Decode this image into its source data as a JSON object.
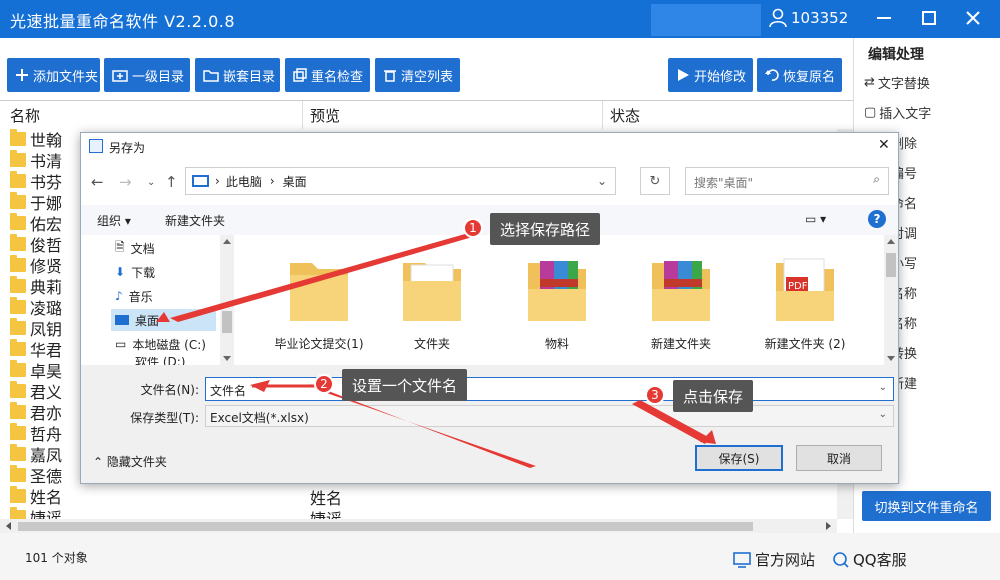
{
  "titlebar": {
    "title": "光速批量重命名软件 V2.2.0.8",
    "user_id": "103352"
  },
  "toolbar": {
    "add_files": "添加文件夹",
    "level1_dir": "一级目录",
    "nested_dir": "嵌套目录",
    "rename_check": "重名检查",
    "clear_list": "清空列表",
    "start_modify": "开始修改",
    "restore_name": "恢复原名"
  },
  "right_panel": {
    "heading": "编辑处理",
    "items": [
      "文字替换",
      "插入文字",
      "好删除",
      "字编号",
      "机命名",
      "字对调",
      "写小写",
      "入名称",
      "出名称",
      "简转换",
      "建新建"
    ],
    "switch_button": "切换到文件重命名"
  },
  "list": {
    "columns": [
      "名称",
      "预览",
      "状态"
    ],
    "rows": [
      {
        "name": "世翰",
        "preview": ""
      },
      {
        "name": "书清",
        "preview": ""
      },
      {
        "name": "书芬",
        "preview": ""
      },
      {
        "name": "于娜",
        "preview": ""
      },
      {
        "name": "佑宏",
        "preview": ""
      },
      {
        "name": "俊哲",
        "preview": ""
      },
      {
        "name": "修贤",
        "preview": ""
      },
      {
        "name": "典莉",
        "preview": ""
      },
      {
        "name": "凌璐",
        "preview": ""
      },
      {
        "name": "凤钥",
        "preview": ""
      },
      {
        "name": "华君",
        "preview": ""
      },
      {
        "name": "卓昊",
        "preview": ""
      },
      {
        "name": "君义",
        "preview": ""
      },
      {
        "name": "君亦",
        "preview": ""
      },
      {
        "name": "哲舟",
        "preview": ""
      },
      {
        "name": "嘉凤",
        "preview": ""
      },
      {
        "name": "圣德",
        "preview": ""
      },
      {
        "name": "姓名",
        "preview": "姓名"
      },
      {
        "name": "婕谣",
        "preview": "婕谣"
      }
    ]
  },
  "statusbar": {
    "count": "101 个对象",
    "website": "官方网站",
    "qq": "QQ客服"
  },
  "dialog": {
    "title": "另存为",
    "path": [
      "此电脑",
      "桌面"
    ],
    "search_placeholder": "搜索\"桌面\"",
    "organize": "组织",
    "new_folder": "新建文件夹",
    "nav_items": [
      "文档",
      "下载",
      "音乐",
      "桌面",
      "本地磁盘 (C:)",
      "软件 (D:)"
    ],
    "files": [
      "毕业论文提交(1)",
      "文件夹",
      "物料",
      "新建文件夹",
      "新建文件夹 (2)"
    ],
    "filename_label": "文件名(N):",
    "filename_value": "文件名",
    "filetype_label": "保存类型(T):",
    "filetype_value": "Excel文档(*.xlsx)",
    "hide_folders": "隐藏文件夹",
    "save": "保存(S)",
    "cancel": "取消"
  },
  "callouts": [
    {
      "num": "1",
      "text": "选择保存路径"
    },
    {
      "num": "2",
      "text": "设置一个文件名"
    },
    {
      "num": "3",
      "text": "点击保存"
    }
  ]
}
